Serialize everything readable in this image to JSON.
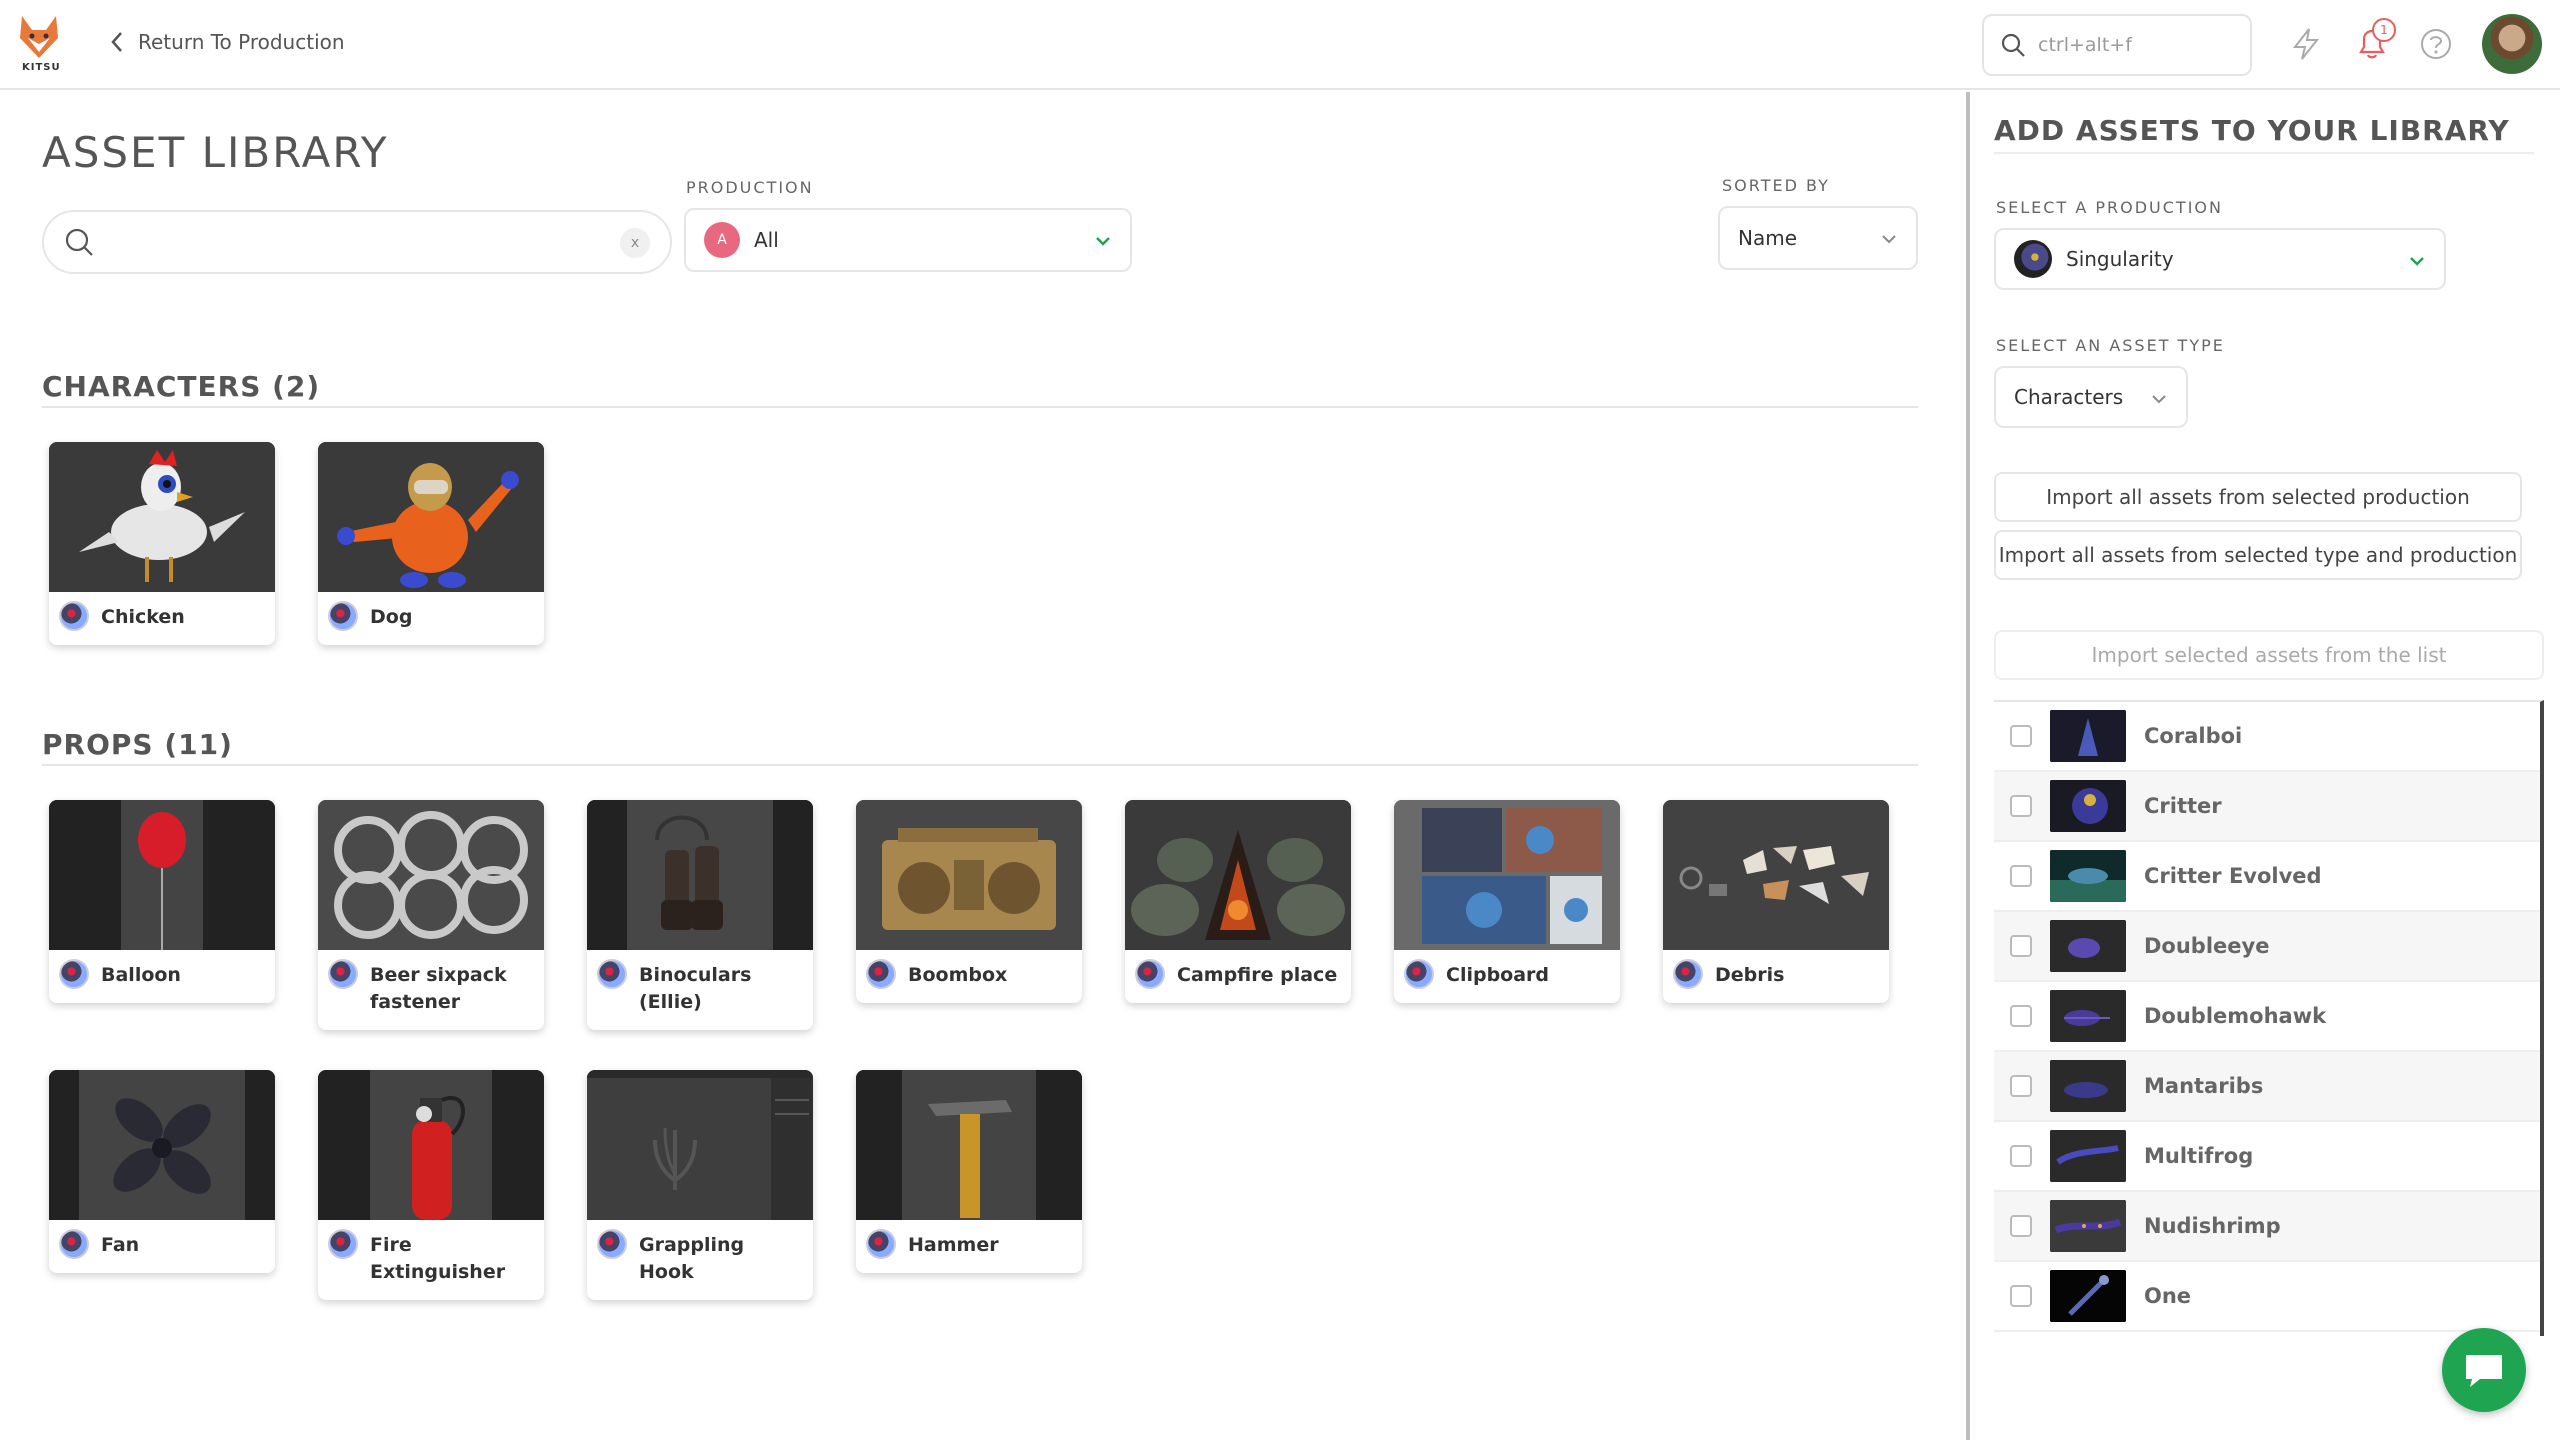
{
  "topbar": {
    "logo_text": "KITSU",
    "back_label": "Return To Production",
    "search_placeholder": "ctrl+alt+f",
    "notification_count": "1"
  },
  "main": {
    "title": "ASSET LIBRARY",
    "search_value": "",
    "clear_label": "x",
    "production_label": "PRODUCTION",
    "production_value": "All",
    "production_avatar": "A",
    "sorted_label": "SORTED BY",
    "sorted_value": "Name"
  },
  "characters": {
    "title": "CHARACTERS (2)",
    "items": [
      {
        "name": "Chicken"
      },
      {
        "name": "Dog"
      }
    ]
  },
  "props": {
    "title": "PROPS (11)",
    "items": [
      {
        "name": "Balloon"
      },
      {
        "name": "Beer sixpack fastener"
      },
      {
        "name": "Binoculars (Ellie)"
      },
      {
        "name": "Boombox"
      },
      {
        "name": "Campfire place"
      },
      {
        "name": "Clipboard"
      },
      {
        "name": "Debris"
      },
      {
        "name": "Fan"
      },
      {
        "name": "Fire Extinguisher"
      },
      {
        "name": "Grappling Hook"
      },
      {
        "name": "Hammer"
      }
    ]
  },
  "side": {
    "title": "ADD ASSETS TO YOUR LIBRARY",
    "production_label": "SELECT A PRODUCTION",
    "production_value": "Singularity",
    "type_label": "SELECT AN ASSET TYPE",
    "type_value": "Characters",
    "import_all_production": "Import all assets from selected production",
    "import_all_type": "Import all assets from selected type and production",
    "import_selected": "Import selected assets from the list",
    "assets": [
      {
        "name": "Coralboi"
      },
      {
        "name": "Critter"
      },
      {
        "name": "Critter Evolved"
      },
      {
        "name": "Doubleeye"
      },
      {
        "name": "Doublemohawk"
      },
      {
        "name": "Mantaribs"
      },
      {
        "name": "Multifrog"
      },
      {
        "name": "Nudishrimp"
      },
      {
        "name": "One"
      }
    ]
  },
  "colors": {
    "accent_green": "#1fa552",
    "notification_red": "#e85d5d",
    "production_pink": "#e8697f"
  }
}
